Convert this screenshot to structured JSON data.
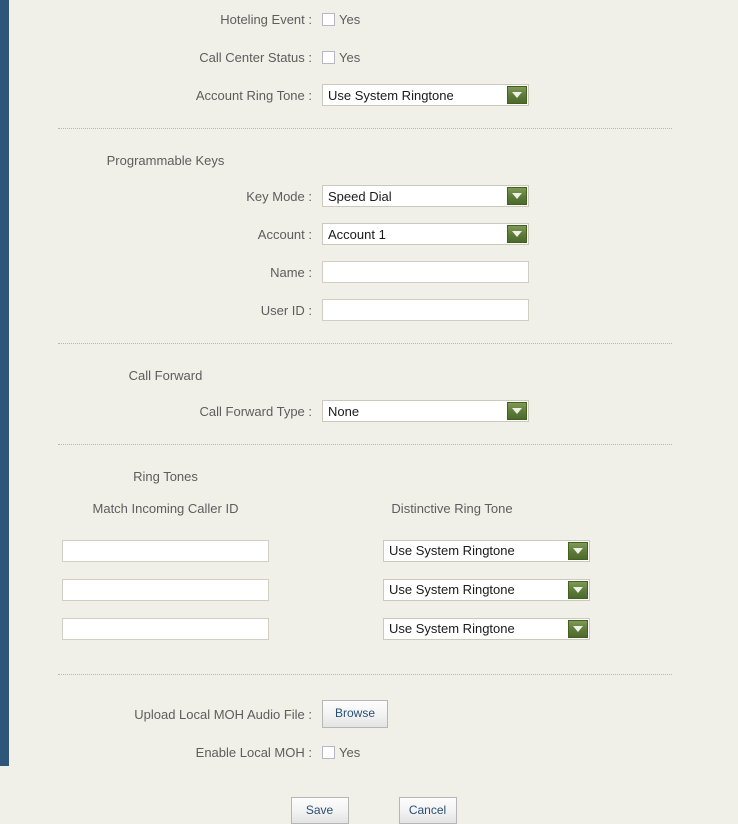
{
  "theme": {
    "page_background": "#f0f0e8",
    "rail_color": "#2e5679",
    "label_color": "#5d5d5d",
    "dropdown_button_color": "#5e7c3a",
    "button_text_color": "#284f73"
  },
  "account_settings": {
    "hoteling_event": {
      "label": "Hoteling Event :",
      "checkbox_label": "Yes",
      "checked": false
    },
    "call_center_status": {
      "label": "Call Center Status :",
      "checkbox_label": "Yes",
      "checked": false
    },
    "account_ring_tone": {
      "label": "Account Ring Tone :",
      "value": "Use System Ringtone"
    }
  },
  "programmable_keys": {
    "section_title": "Programmable Keys",
    "key_mode": {
      "label": "Key Mode :",
      "value": "Speed Dial"
    },
    "account": {
      "label": "Account :",
      "value": "Account 1"
    },
    "name": {
      "label": "Name :",
      "value": "",
      "placeholder": ""
    },
    "user_id": {
      "label": "User ID :",
      "value": "",
      "placeholder": ""
    }
  },
  "call_forward": {
    "section_title": "Call Forward",
    "call_forward_type": {
      "label": "Call Forward Type :",
      "value": "None"
    }
  },
  "ring_tones": {
    "section_title": "Ring Tones",
    "column_headers": {
      "caller_id": "Match Incoming Caller ID",
      "ring_tone": "Distinctive Ring Tone"
    },
    "rows": [
      {
        "caller_id": "",
        "ring_tone": "Use System Ringtone"
      },
      {
        "caller_id": "",
        "ring_tone": "Use System Ringtone"
      },
      {
        "caller_id": "",
        "ring_tone": "Use System Ringtone"
      }
    ]
  },
  "music_on_hold": {
    "upload": {
      "label": "Upload Local MOH Audio File :",
      "button_label": "Browse"
    },
    "enable": {
      "label": "Enable Local MOH :",
      "checkbox_label": "Yes",
      "checked": false
    }
  },
  "actions": {
    "save_label": "Save",
    "cancel_label": "Cancel"
  }
}
